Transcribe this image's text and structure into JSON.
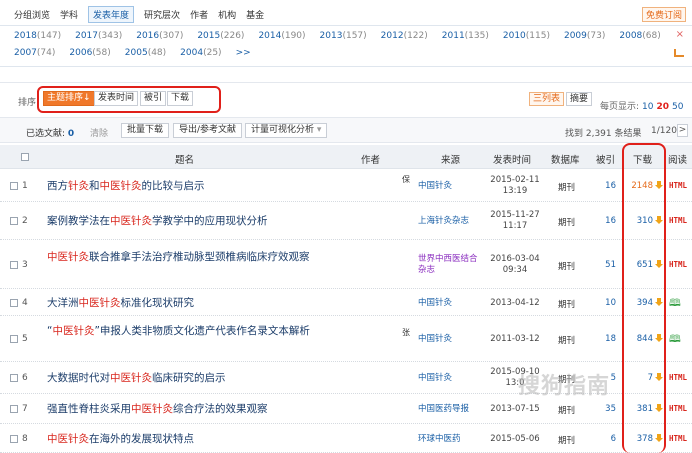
{
  "tabs": [
    "分组浏览",
    "学科",
    "发表年度",
    "研究层次",
    "作者",
    "机构",
    "基金"
  ],
  "active_tab": "发表年度",
  "free_subscribe": "免费订阅",
  "years_row1": [
    {
      "year": "2018",
      "count": "(147)"
    },
    {
      "year": "2017",
      "count": "(343)"
    },
    {
      "year": "2016",
      "count": "(307)"
    },
    {
      "year": "2015",
      "count": "(226)"
    },
    {
      "year": "2014",
      "count": "(190)"
    },
    {
      "year": "2013",
      "count": "(157)"
    },
    {
      "year": "2012",
      "count": "(122)"
    },
    {
      "year": "2011",
      "count": "(135)"
    },
    {
      "year": "2010",
      "count": "(115)"
    },
    {
      "year": "2009",
      "count": "(73)"
    },
    {
      "year": "2008",
      "count": "(68)"
    }
  ],
  "years_row2": [
    {
      "year": "2007",
      "count": "(74)"
    },
    {
      "year": "2006",
      "count": "(58)"
    },
    {
      "year": "2005",
      "count": "(48)"
    },
    {
      "year": "2004",
      "count": "(25)"
    },
    {
      "year": ">>",
      "count": ""
    }
  ],
  "close_glyph": "×",
  "sort": {
    "label": "排序:",
    "options": [
      "主题排序",
      "发表时间",
      "被引",
      "下载"
    ],
    "active_index": 0,
    "active_arrow": "↓"
  },
  "view": {
    "list": "三列表",
    "abstract": "摘要"
  },
  "per_page": {
    "label": "每页显示:",
    "options": [
      "10",
      "20",
      "50"
    ],
    "active": "20"
  },
  "selection": {
    "label": "已选文献:",
    "count": "0",
    "clear": "清除",
    "buttons": [
      "批量下载",
      "导出/参考文献",
      "计量可视化分析"
    ],
    "dropdown_glyph": "▾",
    "found": "找到 2,391 条结果",
    "pager": "1/120",
    "next": ">"
  },
  "columns": {
    "title": "题名",
    "author": "作者",
    "source": "来源",
    "date": "发表时间",
    "db": "数据库",
    "cite": "被引",
    "download": "下载",
    "read": "阅读"
  },
  "rows": [
    {
      "num": "1",
      "title_parts": [
        [
          "西方",
          0
        ],
        [
          "针灸",
          1
        ],
        [
          "和",
          0
        ],
        [
          "中医针灸",
          1
        ],
        [
          "的比较与启示",
          0
        ]
      ],
      "author": "保",
      "source": "中国针灸",
      "source_purple": false,
      "date": [
        "2015-02-11",
        "13:19"
      ],
      "db": "期刊",
      "cite": "16",
      "download": "2148",
      "dl_orange": true,
      "read": "HTML"
    },
    {
      "num": "2",
      "title_parts": [
        [
          "案例教学法在",
          0
        ],
        [
          "中医针灸",
          1
        ],
        [
          "学教学中的应用现状分析",
          0
        ]
      ],
      "author": "",
      "source": "上海针灸杂志",
      "source_purple": false,
      "date": [
        "2015-11-27",
        "11:17"
      ],
      "db": "期刊",
      "cite": "16",
      "download": "310",
      "dl_orange": false,
      "read": "HTML"
    },
    {
      "num": "3",
      "title_parts": [
        [
          "中医针灸",
          1
        ],
        [
          "联合推拿手法治疗椎动脉型颈椎病临床疗效观察",
          0
        ]
      ],
      "author": "",
      "source": "世界中西医结合杂志",
      "source_purple": true,
      "date": [
        "2016-03-04",
        "09:34"
      ],
      "db": "期刊",
      "cite": "51",
      "download": "651",
      "dl_orange": false,
      "read": "HTML"
    },
    {
      "num": "4",
      "title_parts": [
        [
          "大洋洲",
          0
        ],
        [
          "中医针灸",
          1
        ],
        [
          "标准化现状研究",
          0
        ]
      ],
      "author": "",
      "source": "中国针灸",
      "source_purple": false,
      "date": [
        "2013-04-12"
      ],
      "db": "期刊",
      "cite": "10",
      "download": "394",
      "dl_orange": false,
      "read": "book"
    },
    {
      "num": "5",
      "title_parts": [
        [
          "“",
          0
        ],
        [
          "中医针灸",
          1
        ],
        [
          "”申报人类非物质文化遗产代表作名录文本解析",
          0
        ]
      ],
      "author": "张",
      "source": "中国针灸",
      "source_purple": false,
      "date": [
        "2011-03-12"
      ],
      "db": "期刊",
      "cite": "18",
      "download": "844",
      "dl_orange": false,
      "read": "book"
    },
    {
      "num": "6",
      "title_parts": [
        [
          "大数据时代对",
          0
        ],
        [
          "中医针灸",
          1
        ],
        [
          "临床研究的启示",
          0
        ]
      ],
      "author": "",
      "source": "中国针灸",
      "source_purple": false,
      "date": [
        "2015-09-10",
        "13:0"
      ],
      "db": "期刊",
      "cite": "5",
      "download": "7",
      "dl_orange": false,
      "read": "HTML"
    },
    {
      "num": "7",
      "title_parts": [
        [
          "强直性脊柱炎采用",
          0
        ],
        [
          "中医针灸",
          1
        ],
        [
          "综合疗法的效果观察",
          0
        ]
      ],
      "author": "",
      "source": "中国医药导报",
      "source_purple": false,
      "date": [
        "2013-07-15"
      ],
      "db": "期刊",
      "cite": "35",
      "download": "381",
      "dl_orange": false,
      "read": "HTML"
    },
    {
      "num": "8",
      "title_parts": [
        [
          "中医针灸",
          1
        ],
        [
          "在海外的发展现状特点",
          0
        ]
      ],
      "author": "",
      "source": "环球中医药",
      "source_purple": false,
      "date": [
        "2015-05-06"
      ],
      "db": "期刊",
      "cite": "6",
      "download": "378",
      "dl_orange": false,
      "read": "HTML"
    }
  ],
  "read_book_glyph": "🕮",
  "watermark": "搜狗指南"
}
